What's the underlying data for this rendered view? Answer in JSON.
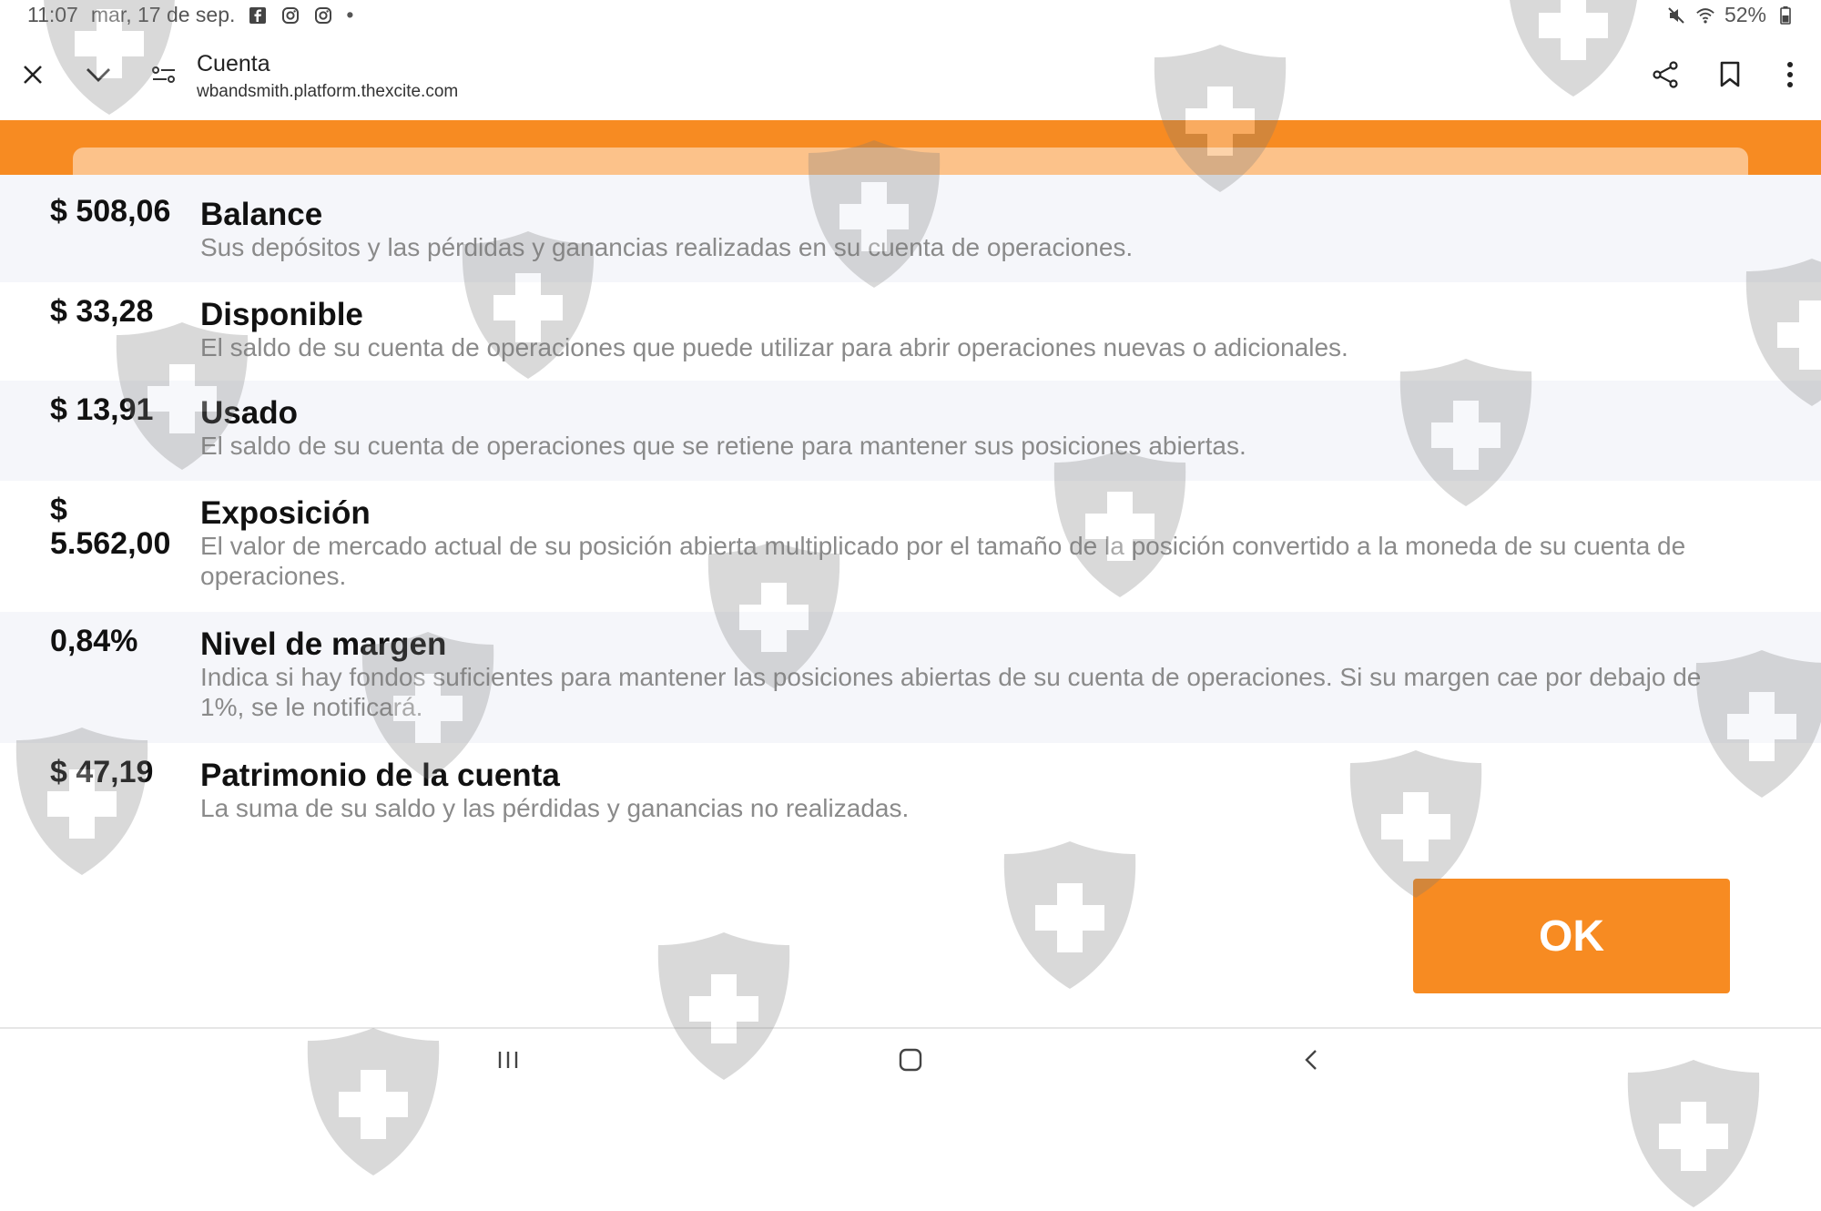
{
  "status_bar": {
    "time": "11:07",
    "date": "mar, 17 de sep.",
    "battery": "52%",
    "dot": "•",
    "icons": [
      "facebook-icon",
      "instagram-icon",
      "instagram-icon",
      "mute-icon",
      "wifi-icon",
      "battery-icon"
    ]
  },
  "toolbar": {
    "title": "Cuenta",
    "url": "wbandsmith.platform.thexcite.com",
    "icons": [
      "close-icon",
      "chevron-down-icon",
      "site-settings-icon",
      "share-icon",
      "bookmark-icon",
      "more-vert-icon"
    ]
  },
  "rows": [
    {
      "value": "$ 508,06",
      "label": "Balance",
      "description": "Sus depósitos y las pérdidas y ganancias realizadas en su cuenta de operaciones."
    },
    {
      "value": "$ 33,28",
      "label": "Disponible",
      "description": "El saldo de su cuenta de operaciones que puede utilizar para abrir operaciones nuevas o adicionales."
    },
    {
      "value": "$ 13,91",
      "label": "Usado",
      "description": "El saldo de su cuenta de operaciones que se retiene para mantener sus posiciones abiertas."
    },
    {
      "value": "$ 5.562,00",
      "label": "Exposición",
      "description": "El valor de mercado actual de su posición abierta multiplicado por el tamaño de la posición convertido a la moneda de su cuenta de operaciones."
    },
    {
      "value": "0,84%",
      "label": "Nivel de margen",
      "description": "Indica si hay fondos suficientes para mantener las posiciones abiertas de su cuenta de operaciones. Si su margen cae por debajo de 1%, se le notificará."
    },
    {
      "value": "$ 47,19",
      "label": "Patrimonio de la cuenta",
      "description": "La suma de su saldo y las pérdidas y ganancias no realizadas."
    }
  ],
  "ok_button": {
    "label": "OK"
  },
  "colors": {
    "accent": "#f78b22",
    "accent_light": "#fcc28a",
    "description_text": "#8a8a8a",
    "row_alt": "#f5f6fa"
  },
  "nav_bar": {
    "icons": [
      "recent-apps-icon",
      "home-icon",
      "back-icon"
    ]
  }
}
